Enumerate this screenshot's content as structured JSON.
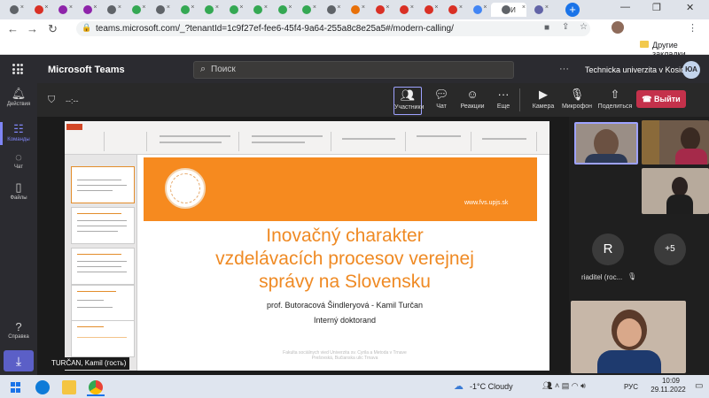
{
  "browser": {
    "url": "teams.microsoft.com/_?tenantId=1c9f27ef-fee6-45f4-9a64-255a8c8e25a5#/modern-calling/",
    "active_tab_label": "И",
    "bookmarks_folder": "Другие закладки",
    "tab_colors": [
      "#5f6368",
      "#d93025",
      "#8e24aa",
      "#8e24aa",
      "#5f6368",
      "#34a853",
      "#5f6368",
      "#34a853",
      "#34a853",
      "#34a853",
      "#34a853",
      "#34a853",
      "#34a853",
      "#5f6368",
      "#e8710a",
      "#d93025",
      "#d93025",
      "#d93025",
      "#d93025",
      "#4285f4",
      "#5f6368",
      "#6264a7"
    ]
  },
  "teams": {
    "app_name": "Microsoft Teams",
    "search_placeholder": "Поиск",
    "more": "···",
    "organization": "Technicka univerzita v Kosiciach",
    "user_initials": "ЮА",
    "accent": "#5b5fc7"
  },
  "rail": {
    "items": [
      {
        "label": "Действия",
        "icon": "bell-icon"
      },
      {
        "label": "Команды",
        "icon": "teams-icon"
      },
      {
        "label": "Чат",
        "icon": "chat-icon"
      },
      {
        "label": "Файлы",
        "icon": "file-icon"
      },
      {
        "label": "Справка",
        "icon": "help-icon"
      }
    ]
  },
  "meeting": {
    "timer": "--:--",
    "controls": {
      "participants": "Участники",
      "chat": "Чат",
      "reactions": "Реакции",
      "more": "Еще",
      "camera": "Камера",
      "mic": "Микрофон",
      "share": "Поделиться"
    },
    "leave": "Выйти",
    "leave_color": "#c4314b",
    "stage_label": "TURČAN, Kamil (гость)"
  },
  "slide": {
    "url": "www.fvs.upjs.sk",
    "title_lines": [
      "Inovačný charakter",
      "vzdelávacích procesov verejnej",
      "správy na Slovensku"
    ],
    "authors": "prof. Butoracová Šindleryová - Kamil Turčan",
    "role": "Interný doktorand",
    "footer_lines": [
      "Fakulta sociálnych vied Univerzita sv. Cyrila a Metoda v Trnave",
      "Prešovská, Bučianska ulic Trnava"
    ],
    "accent": "#f68a1f"
  },
  "participants": {
    "r_initial": "R",
    "r_name": "riaditel (roc...",
    "overflow": "+5"
  },
  "taskbar": {
    "weather": "-1°C  Cloudy",
    "lang": "РУС",
    "time": "10:09",
    "date": "29.11.2022"
  }
}
